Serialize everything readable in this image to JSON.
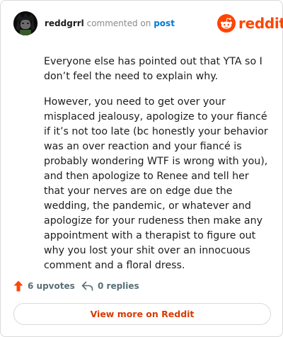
{
  "header": {
    "username": "reddgrrl",
    "action_text": "commented on",
    "post_link": "post",
    "logo_text": "reddit",
    "avatar_icon": "avatar-icon",
    "logo_icon": "reddit-snoo-icon"
  },
  "comment": {
    "paragraphs": [
      "Everyone else has pointed out that YTA so I don’t feel the need to explain why.",
      "However, you need to get over your misplaced jealousy, apologize to your fiancé if it’s not too late (bc honestly your behavior was an over reaction and your fiancé is probably wondering WTF is wrong with you), and then apologize to Renee and tell her that your nerves are on edge due the wedding, the pandemic, or whatever and apologize for your rudeness then make any appointment with a therapist to figure out why you lost your shit over an innocuous comment and a floral dress."
    ]
  },
  "actions": {
    "upvotes_label": "6 upvotes",
    "replies_label": "0 replies",
    "upvote_icon": "upvote-arrow-icon",
    "reply_icon": "reply-arrow-icon"
  },
  "footer": {
    "view_more_label": "View more on Reddit"
  },
  "colors": {
    "brand": "#ff4500",
    "link": "#0079d3",
    "view_more_text": "#d93a00"
  }
}
